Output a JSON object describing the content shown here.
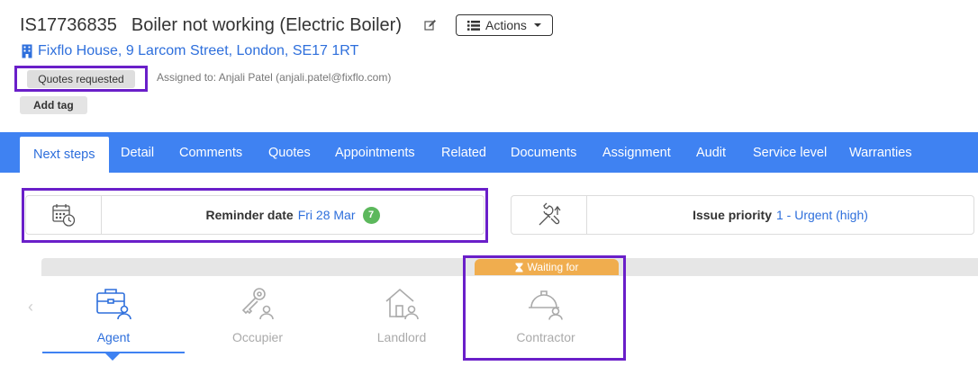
{
  "header": {
    "issue_ref": "IS17736835",
    "issue_title": "Boiler not working (Electric Boiler)",
    "edit_icon": "edit-icon",
    "actions_label": "Actions",
    "address": "Fixflo House, 9 Larcom Street, London, SE17 1RT",
    "status_badge": "Quotes requested",
    "assigned_to": "Assigned to: Anjali Patel (anjali.patel@fixflo.com)",
    "add_tag_label": "Add tag"
  },
  "tabs": [
    {
      "label": "Next steps",
      "active": true
    },
    {
      "label": "Detail"
    },
    {
      "label": "Comments"
    },
    {
      "label": "Quotes"
    },
    {
      "label": "Appointments"
    },
    {
      "label": "Related"
    },
    {
      "label": "Documents"
    },
    {
      "label": "Assignment"
    },
    {
      "label": "Audit"
    },
    {
      "label": "Service level"
    },
    {
      "label": "Warranties"
    }
  ],
  "reminder": {
    "label": "Reminder date",
    "value": "Fri 28 Mar",
    "count": "7",
    "icon": "calendar-clock-icon"
  },
  "priority": {
    "label": "Issue priority",
    "value": "1 - Urgent (high)",
    "icon": "wrench-priority-icon"
  },
  "workflow": {
    "waiting_label": "Waiting for",
    "steps": [
      {
        "label": "Agent",
        "icon": "briefcase-user-icon",
        "active": true
      },
      {
        "label": "Occupier",
        "icon": "key-user-icon"
      },
      {
        "label": "Landlord",
        "icon": "house-user-icon"
      },
      {
        "label": "Contractor",
        "icon": "hardhat-user-icon",
        "waiting": true
      }
    ]
  },
  "colors": {
    "accent": "#3f82f2",
    "link": "#2e6fdc",
    "highlight": "#6a1fc9",
    "waiting": "#f0ad4e",
    "badge_green": "#5cb85c"
  }
}
